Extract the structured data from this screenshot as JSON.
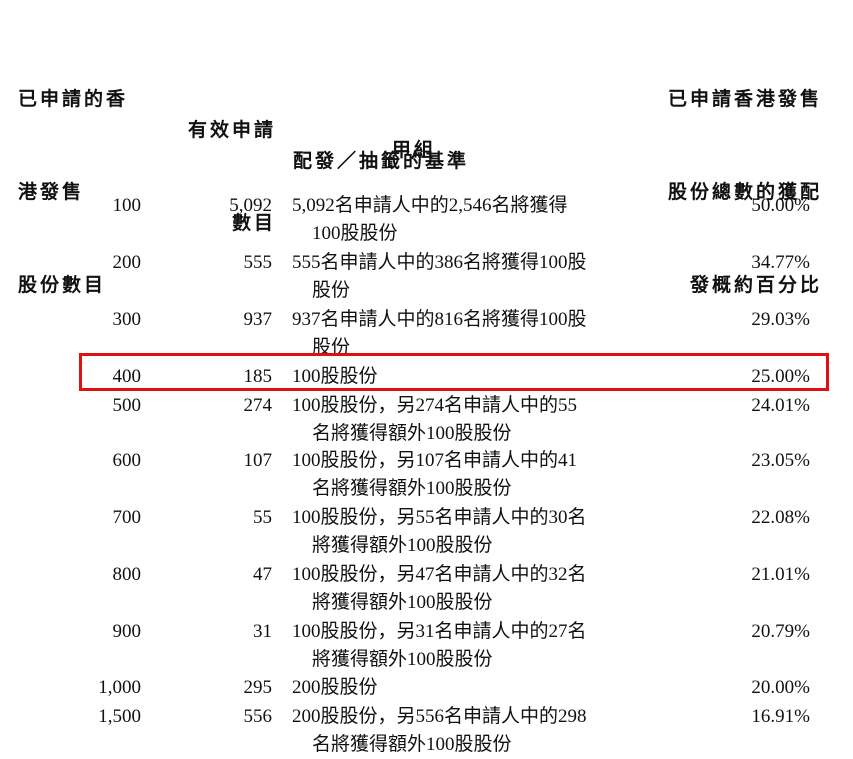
{
  "headers": {
    "col1": [
      "已申請的香",
      "港發售",
      "股份數目"
    ],
    "col2": [
      "有效申請",
      "數目"
    ],
    "col3": "配發／抽籤的基準",
    "col4": [
      "已申請香港發售",
      "股份總數的獲配",
      "發概約百分比"
    ]
  },
  "group": "甲組",
  "rows": [
    {
      "shares": "100",
      "apps": "5,092",
      "basis": [
        "5,092名申請人中的2,546名將獲得",
        "100股股份"
      ],
      "pct": "50.00%"
    },
    {
      "shares": "200",
      "apps": "555",
      "basis": [
        "555名申請人中的386名將獲得100股",
        "股份"
      ],
      "pct": "34.77%"
    },
    {
      "shares": "300",
      "apps": "937",
      "basis": [
        "937名申請人中的816名將獲得100股",
        "股份"
      ],
      "pct": "29.03%"
    },
    {
      "shares": "400",
      "apps": "185",
      "basis": [
        "100股股份",
        ""
      ],
      "pct": "25.00%"
    },
    {
      "shares": "500",
      "apps": "274",
      "basis": [
        "100股股份，另274名申請人中的55",
        "名將獲得額外100股股份"
      ],
      "pct": "24.01%"
    },
    {
      "shares": "600",
      "apps": "107",
      "basis": [
        "100股股份，另107名申請人中的41",
        "名將獲得額外100股股份"
      ],
      "pct": "23.05%"
    },
    {
      "shares": "700",
      "apps": "55",
      "basis": [
        "100股股份，另55名申請人中的30名",
        "將獲得額外100股股份"
      ],
      "pct": "22.08%"
    },
    {
      "shares": "800",
      "apps": "47",
      "basis": [
        "100股股份，另47名申請人中的32名",
        "將獲得額外100股股份"
      ],
      "pct": "21.01%"
    },
    {
      "shares": "900",
      "apps": "31",
      "basis": [
        "100股股份，另31名申請人中的27名",
        "將獲得額外100股股份"
      ],
      "pct": "20.79%"
    },
    {
      "shares": "1,000",
      "apps": "295",
      "basis": [
        "200股股份",
        ""
      ],
      "pct": "20.00%"
    },
    {
      "shares": "1,500",
      "apps": "556",
      "basis": [
        "200股股份，另556名申請人中的298",
        "名將獲得額外100股股份"
      ],
      "pct": "16.91%"
    }
  ],
  "highlight_color": "#e01010"
}
